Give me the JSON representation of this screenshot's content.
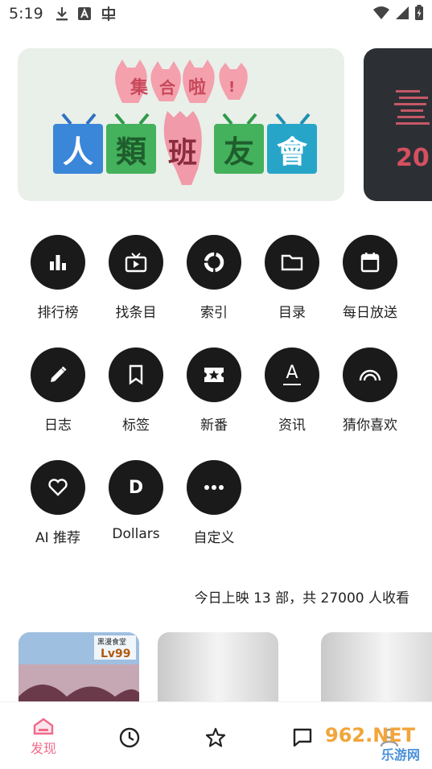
{
  "status_bar": {
    "time": "5:19",
    "icons_left": [
      "download-icon",
      "a-badge-icon",
      "bug-icon"
    ],
    "icons_right": [
      "wifi-icon",
      "signal-icon",
      "battery-charging-icon"
    ]
  },
  "banner": {
    "line1": "集合啦!",
    "line2": [
      "人",
      "類",
      "班",
      "友",
      "會"
    ],
    "side_text": "20"
  },
  "grid": {
    "items": [
      {
        "label": "排行榜",
        "icon": "bar-chart-icon"
      },
      {
        "label": "找条目",
        "icon": "tv-play-icon"
      },
      {
        "label": "索引",
        "icon": "ring-index-icon"
      },
      {
        "label": "目录",
        "icon": "folder-icon"
      },
      {
        "label": "每日放送",
        "icon": "calendar-icon"
      },
      {
        "label": "日志",
        "icon": "pencil-icon"
      },
      {
        "label": "标签",
        "icon": "bookmark-icon"
      },
      {
        "label": "新番",
        "icon": "ticket-star-icon"
      },
      {
        "label": "资讯",
        "icon": "letter-a-icon"
      },
      {
        "label": "猜你喜欢",
        "icon": "rainbow-icon"
      },
      {
        "label": "AI 推荐",
        "icon": "heart-icon"
      },
      {
        "label": "Dollars",
        "icon": "letter-d-icon"
      },
      {
        "label": "自定义",
        "icon": "more-dots-icon"
      }
    ],
    "letter_a": "A",
    "letter_d": "D"
  },
  "summary": "今日上映 13 部，共 27000 人收看",
  "cards": {
    "card1_title": "黑漫食堂",
    "card1_badge": "Lv99"
  },
  "bottom_nav": {
    "discover_label": "发现",
    "icons": [
      "home-icon",
      "clock-icon",
      "star-icon",
      "chat-icon",
      "user-icon"
    ]
  },
  "watermark": {
    "top": "962.NET",
    "bottom": "乐游网"
  },
  "colors": {
    "accent": "#f06a8a",
    "icon_circle": "#1a1a1a"
  }
}
